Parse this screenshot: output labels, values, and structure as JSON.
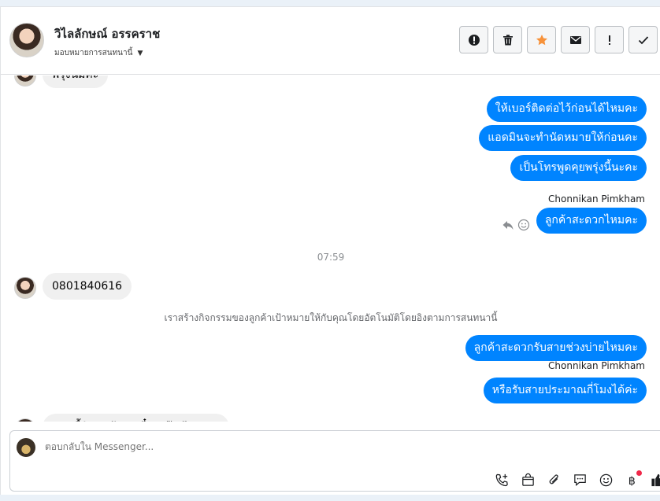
{
  "header": {
    "contact_name": "วิไลลักษณ์ อรรคราช",
    "assign_label": "มอบหมายการสนทนานี้",
    "actions": [
      "spam-icon",
      "trash-icon",
      "star-icon",
      "mail-icon",
      "exclamation-icon",
      "check-icon"
    ]
  },
  "messages": {
    "partial_top": "พรุ่งนี้มีค่ะ",
    "out1": "ให้เบอร์ติดต่อไว้ก่อนได้ไหมคะ",
    "out2": "แอดมินจะทำนัดหมายให้ก่อนคะ",
    "out3": "เป็นโทรพูดคุยพรุ่งนี้นะคะ",
    "sender1": "Chonnikan Pimkham",
    "out4": "ลูกค้าสะดวกไหมคะ",
    "timestamp": "07:59",
    "in1": "0801840616",
    "system": "เราสร้างกิจกรรมของลูกค้าเป้าหมายให้กับคุณโดยอัตโนมัติโดยอิงตามการสนทนานี้",
    "out5": "ลูกค้าสะดวกรับสายช่วงบ่ายไหมคะ",
    "sender2": "Chonnikan Pimkham",
    "out6": "หรือรับสายประมาณกี่โมงได้ค่ะ",
    "partial_bottom": "ตอนนี้ติดลูกค้าอยู่เดี๋ยวแป๊บนึงนะคะ"
  },
  "composer": {
    "placeholder": "ตอบกลับใน Messenger...",
    "tools": [
      "call-add-icon",
      "shop-icon",
      "attach-icon",
      "saved-reply-icon",
      "emoji-icon",
      "baht-icon",
      "like-icon"
    ]
  },
  "colors": {
    "accent": "#0084ff",
    "star": "#f7923a",
    "notify": "#f02849"
  }
}
